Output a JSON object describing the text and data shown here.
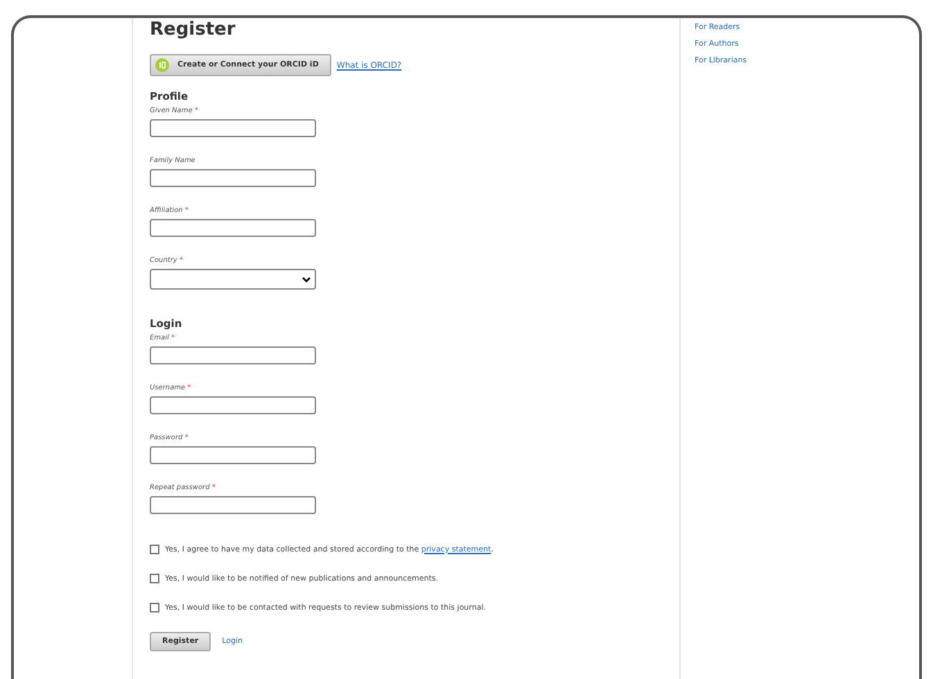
{
  "title": "Register",
  "orcid": {
    "button": "Create or Connect your ORCID iD",
    "link": "What is ORCID?"
  },
  "sections": [
    {
      "title": "Profile",
      "fields": [
        {
          "label": "Given Name",
          "required": true,
          "kind": "text"
        },
        {
          "label": "Family Name",
          "required": false,
          "kind": "text"
        },
        {
          "label": "Affiliation",
          "required": true,
          "kind": "text"
        },
        {
          "label": "Country",
          "required": true,
          "kind": "select"
        }
      ]
    },
    {
      "title": "Login",
      "fields": [
        {
          "label": "Email",
          "required": true,
          "kind": "text"
        },
        {
          "label": "Username",
          "required": true,
          "kind": "text"
        },
        {
          "label": "Password",
          "required": true,
          "kind": "text"
        },
        {
          "label": "Repeat password",
          "required": true,
          "kind": "text"
        }
      ]
    }
  ],
  "required_mark": "*",
  "checkboxes": [
    {
      "text": "Yes, I agree to have my data collected and stored according to the",
      "link": "privacy statement",
      "after": ".",
      "checked": false
    },
    {
      "text": "Yes, I would like to be notified of new publications and announcements.",
      "checked": false
    },
    {
      "text": "Yes, I would like to be contacted with requests to review submissions to this journal.",
      "checked": false
    }
  ],
  "buttons": {
    "register": "Register",
    "login": "Login"
  },
  "sidebar": {
    "items": [
      "For Readers",
      "For Authors",
      "For Librarians"
    ]
  }
}
